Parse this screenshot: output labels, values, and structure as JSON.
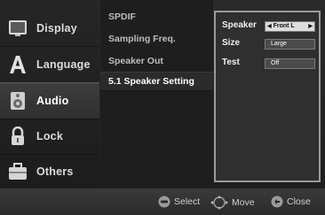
{
  "nav": {
    "items": [
      {
        "label": "Display",
        "icon": "display-icon"
      },
      {
        "label": "Language",
        "icon": "language-icon"
      },
      {
        "label": "Audio",
        "icon": "audio-icon"
      },
      {
        "label": "Lock",
        "icon": "lock-icon"
      },
      {
        "label": "Others",
        "icon": "others-icon"
      }
    ]
  },
  "submenu": {
    "items": [
      "SPDIF",
      "Sampling Freq.",
      "Speaker Out",
      "5.1 Speaker Setting"
    ]
  },
  "panel": {
    "speaker_label": "Speaker",
    "speaker_value": "Front L",
    "size_label": "Size",
    "size_value": "Large",
    "test_label": "Test",
    "test_value": "Off"
  },
  "footer": {
    "select_label": "Select",
    "move_label": "Move",
    "close_label": "Close"
  }
}
